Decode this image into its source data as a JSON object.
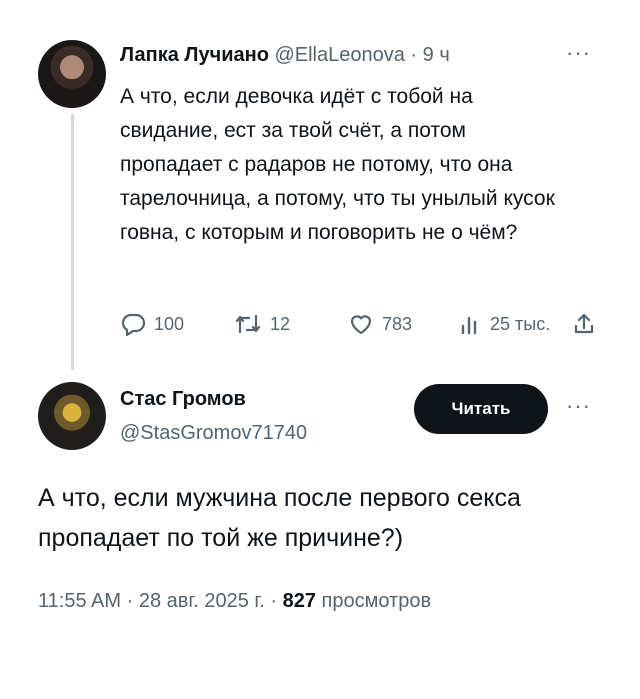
{
  "tweet1": {
    "author_name": "Лапка Лучиано",
    "author_handle": "@EllaLeonova",
    "separator": "·",
    "time": "9 ч",
    "more": "···",
    "text": "А что, если девочка идёт с тобой на свидание, ест за твой счёт, а потом пропадает с радаров не потому, что она тарелочница, а потому, что ты унылый кусок говна, с которым и поговорить не о чём?",
    "actions": {
      "replies": "100",
      "retweets": "12",
      "likes": "783",
      "views": "25 тыс."
    }
  },
  "tweet2": {
    "author_name": "Стас Громов",
    "author_handle": "@StasGromov71740",
    "follow_label": "Читать",
    "more": "···",
    "text": "А что, если мужчина после первого секса пропадает по той же причине?)",
    "time": "11:55 AM",
    "date": "28 авг. 2025 г.",
    "separator": "·",
    "views_count": "827",
    "views_label": "просмотров"
  },
  "icons": {
    "reply": "reply-icon",
    "retweet": "retweet-icon",
    "like": "heart-icon",
    "views": "views-icon",
    "share": "share-icon"
  }
}
